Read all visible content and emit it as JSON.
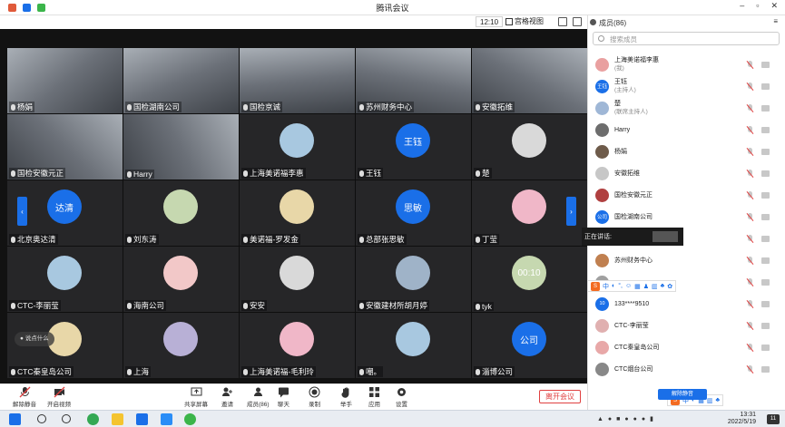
{
  "window": {
    "title": "腾讯会议"
  },
  "header": {
    "timer": "12:10",
    "view_label": "宫格视图"
  },
  "grid": {
    "tiles": [
      {
        "name": "杨娟",
        "kind": "video"
      },
      {
        "name": "国检湖南公司",
        "kind": "video"
      },
      {
        "name": "国检京诚",
        "kind": "video"
      },
      {
        "name": "苏州财务中心",
        "kind": "video"
      },
      {
        "name": "安徽拓维",
        "kind": "video"
      },
      {
        "name": "国检安徽元正",
        "kind": "video"
      },
      {
        "name": "Harry",
        "kind": "video"
      },
      {
        "name": "上海美诺福李惠",
        "kind": "avatar"
      },
      {
        "name": "王钰",
        "kind": "text-avatar",
        "avatar_text": "王钰"
      },
      {
        "name": "楚",
        "kind": "avatar"
      },
      {
        "name": "北京奥达清",
        "kind": "text-avatar",
        "avatar_text": "达清"
      },
      {
        "name": "刘东涛",
        "kind": "avatar"
      },
      {
        "name": "美诺福-罗发金",
        "kind": "avatar"
      },
      {
        "name": "总部张思敏",
        "kind": "text-avatar",
        "avatar_text": "思敏"
      },
      {
        "name": "丁莹",
        "kind": "avatar"
      },
      {
        "name": "CTC-李丽莹",
        "kind": "avatar"
      },
      {
        "name": "海南公司",
        "kind": "avatar"
      },
      {
        "name": "安安",
        "kind": "avatar"
      },
      {
        "name": "安徽建材所胡月婷",
        "kind": "avatar"
      },
      {
        "name": "tyk",
        "kind": "avatar",
        "avatar_text": "00:10"
      },
      {
        "name": "CTC秦皇岛公司",
        "kind": "avatar"
      },
      {
        "name": "上海",
        "kind": "avatar"
      },
      {
        "name": "上海美诺福-毛利玲",
        "kind": "avatar"
      },
      {
        "name": "嘲。",
        "kind": "avatar"
      },
      {
        "name": "淄博公司",
        "kind": "text-avatar",
        "avatar_text": "公司"
      }
    ],
    "hover_hint": "说点什么"
  },
  "toolbar": {
    "unmute": "解除静音",
    "video": "开启视频",
    "share": "共享屏幕",
    "invite": "邀请",
    "members": "成员(86)",
    "chat": "聊天",
    "record": "录制",
    "raise_hand": "举手",
    "apps": "应用",
    "settings": "设置",
    "end_meeting": "离开会议"
  },
  "panel": {
    "title": "成员(86)",
    "search_placeholder": "搜索成员",
    "members": [
      {
        "name": "上海美诺福李惠",
        "sub": "(我)"
      },
      {
        "name": "王钰",
        "sub": "(主持人)",
        "avatar_text": "王钰"
      },
      {
        "name": "楚",
        "sub": "(联席主持人)"
      },
      {
        "name": "Harry",
        "sub": ""
      },
      {
        "name": "杨娟",
        "sub": ""
      },
      {
        "name": "安徽拓维",
        "sub": ""
      },
      {
        "name": "国检安徽元正",
        "sub": ""
      },
      {
        "name": "国检湖南公司",
        "sub": "",
        "avatar_text": "公司"
      },
      {
        "name": "",
        "sub": ""
      },
      {
        "name": "苏州财务中心",
        "sub": ""
      },
      {
        "name": "",
        "sub": ""
      },
      {
        "name": "133****9510",
        "sub": "",
        "avatar_text": "10"
      },
      {
        "name": "CTC-李丽莹",
        "sub": ""
      },
      {
        "name": "CTC秦皇岛公司",
        "sub": ""
      },
      {
        "name": "CTC烟台公司",
        "sub": ""
      }
    ],
    "speaking_label": "正在讲话:",
    "unmute_all": "解除静音"
  },
  "ime": {
    "lang": "中"
  },
  "taskbar": {
    "time": "13:31",
    "date": "2022/5/19",
    "notifications": "11"
  },
  "colors": {
    "accent": "#1a6fe8",
    "danger": "#e04040"
  }
}
